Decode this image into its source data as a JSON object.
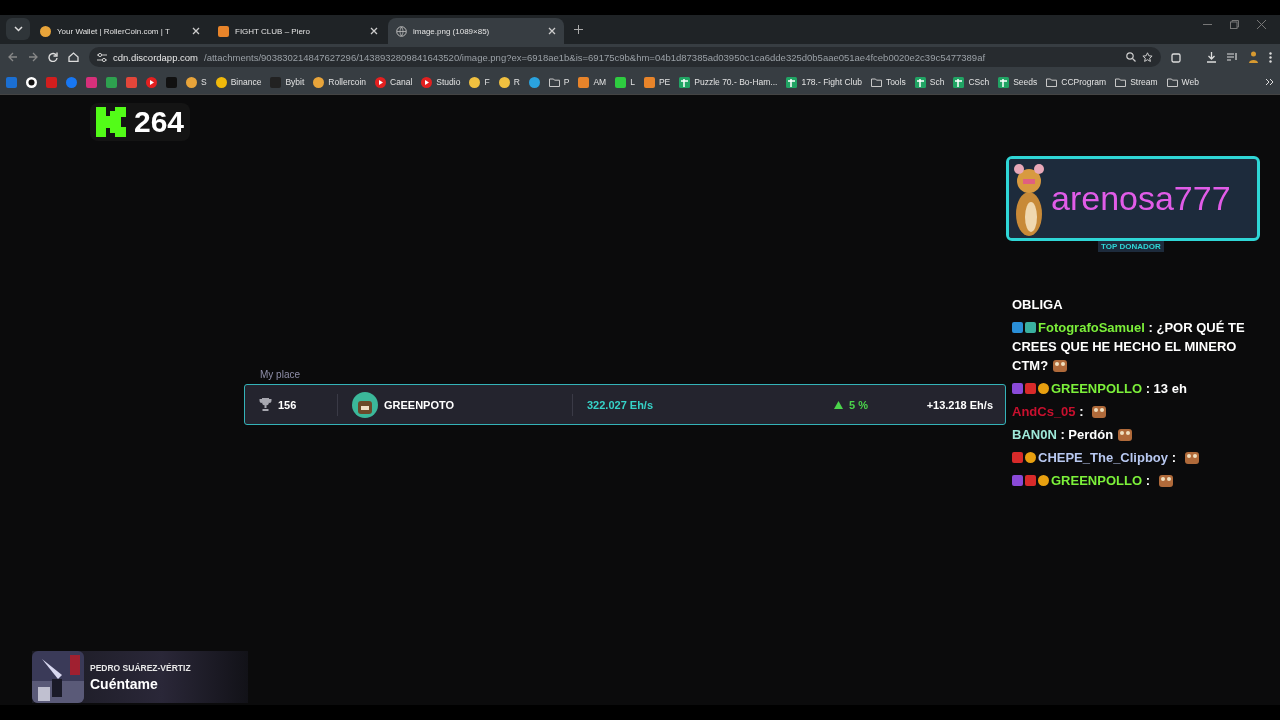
{
  "browser": {
    "tabs": [
      {
        "title": "Your Wallet | RollerCoin.com | T",
        "kind": "roller",
        "selected": false
      },
      {
        "title": "FIGHT CLUB – Piero",
        "kind": "fight",
        "selected": false
      },
      {
        "title": "image.png (1089×85)",
        "kind": "globe",
        "selected": true
      }
    ],
    "address": {
      "host": "cdn.discordapp.com",
      "path": "/attachments/903830214847627296/1438932809841643520/image.png?ex=6918ae1b&is=69175c9b&hm=04b1d87385ad03950c1ca6dde325d0b5aae051ae4fceb0020e2c39c5477389af"
    },
    "bookmarks": [
      {
        "kind": "outlook"
      },
      {
        "kind": "ring"
      },
      {
        "kind": "netflix"
      },
      {
        "kind": "facebook"
      },
      {
        "kind": "instagram"
      },
      {
        "kind": "drive"
      },
      {
        "kind": "gmail"
      },
      {
        "kind": "youtube"
      },
      {
        "kind": "x"
      },
      {
        "kind": "roller",
        "label": "S"
      },
      {
        "kind": "binance",
        "label": "Binance"
      },
      {
        "kind": "bybit",
        "label": "Bybit"
      },
      {
        "kind": "roller",
        "label": "Rollercoin"
      },
      {
        "kind": "youtube",
        "label": "Canal"
      },
      {
        "kind": "youtube",
        "label": "Studio"
      },
      {
        "kind": "face",
        "label": "F"
      },
      {
        "kind": "face",
        "label": "R"
      },
      {
        "kind": "telegram"
      },
      {
        "kind": "folder",
        "label": "P"
      },
      {
        "kind": "fight",
        "label": "AM"
      },
      {
        "kind": "green",
        "label": "L"
      },
      {
        "kind": "fight",
        "label": "PE"
      },
      {
        "kind": "sheet",
        "label": "Puzzle 70.- Bo-Ham..."
      },
      {
        "kind": "sheet",
        "label": "178.- Fight Club"
      },
      {
        "kind": "folder",
        "label": "Tools"
      },
      {
        "kind": "sheet",
        "label": "Sch"
      },
      {
        "kind": "sheet",
        "label": "CSch"
      },
      {
        "kind": "sheet",
        "label": "Seeds"
      },
      {
        "kind": "folder",
        "label": "CCProgram"
      },
      {
        "kind": "folder",
        "label": "Stream"
      },
      {
        "kind": "folder",
        "label": "Web"
      }
    ]
  },
  "viewer_count": "264",
  "donor": {
    "name": "arenosa777",
    "label": "TOP DONADOR"
  },
  "chat": [
    {
      "text": "OBLIGA",
      "emote": false
    },
    {
      "user": "FotografoSamuel",
      "color": "#7cf03a",
      "separator": ":",
      "text": "¿POR QUÉ TE CREES QUE HE HECHO EL MINERO CTM?",
      "badges": [
        {
          "kind": "tool"
        },
        {
          "kind": "pixel"
        }
      ],
      "emote": true
    },
    {
      "user": "GREENPOLLO",
      "color": "#7cf03a",
      "separator": ":",
      "text": "13 eh",
      "badges": [
        {
          "kind": "gem"
        },
        {
          "kind": "sub"
        },
        {
          "kind": "coin"
        }
      ],
      "emote": false
    },
    {
      "user": "AndCs_05",
      "color": "#c8102e",
      "separator": ":",
      "emote": true
    },
    {
      "user": "BAN0N",
      "color": "#9ee8d8",
      "separator": ":",
      "text": "Perdón",
      "emote": true
    },
    {
      "user": "CHEPE_The_Clipboy",
      "color": "#b8c8f0",
      "separator": ":",
      "badges": [
        {
          "kind": "sub"
        },
        {
          "kind": "coin"
        }
      ],
      "emote": true
    },
    {
      "user": "GREENPOLLO",
      "color": "#7cf03a",
      "separator": ":",
      "badges": [
        {
          "kind": "gem"
        },
        {
          "kind": "sub"
        },
        {
          "kind": "coin"
        }
      ],
      "emote": true
    }
  ],
  "leaderboard": {
    "label": "My place",
    "rank": "156",
    "name": "GREENPOTO",
    "power": "322.027 Eh/s",
    "change": "5 %",
    "rising": true,
    "delta": "+13.218 Eh/s"
  },
  "music": {
    "artist": "PEDRO SUÁREZ-VÉRTIZ",
    "title": "Cuéntame"
  }
}
